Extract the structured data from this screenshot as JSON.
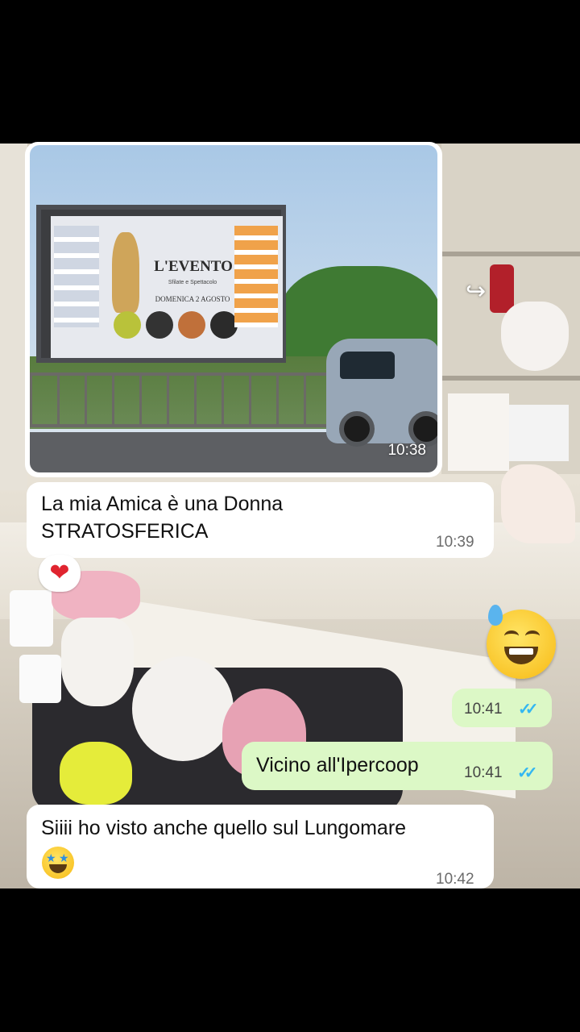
{
  "messages": {
    "image_message": {
      "time": "10:38",
      "billboard_title": "L'EVENTO",
      "billboard_subtitle": "Sfilate e Spettacolo",
      "billboard_date": "DOMENICA 2 AGOSTO"
    },
    "msg1": {
      "text_line1": "La mia Amica è una Donna",
      "text_line2": "STRATOSFERICA",
      "time": "10:39",
      "reaction": "❤"
    },
    "sticker_message": {
      "time": "10:41",
      "ticks": "✓✓"
    },
    "msg2": {
      "text": "Vicino all'Ipercoop",
      "time": "10:41",
      "ticks": "✓✓"
    },
    "msg3": {
      "text": "Siiii ho visto anche quello sul Lungomare",
      "time": "10:42"
    }
  },
  "colors": {
    "incoming_bubble": "#ffffff",
    "outgoing_bubble": "#dcf8c6",
    "read_ticks": "#34b7f1",
    "heart": "#e0242f"
  },
  "icons": {
    "forward": "forward-icon",
    "reaction": "heart-icon",
    "sticker": "grinning-sweat-face-icon",
    "emoji": "star-struck-face-icon"
  }
}
